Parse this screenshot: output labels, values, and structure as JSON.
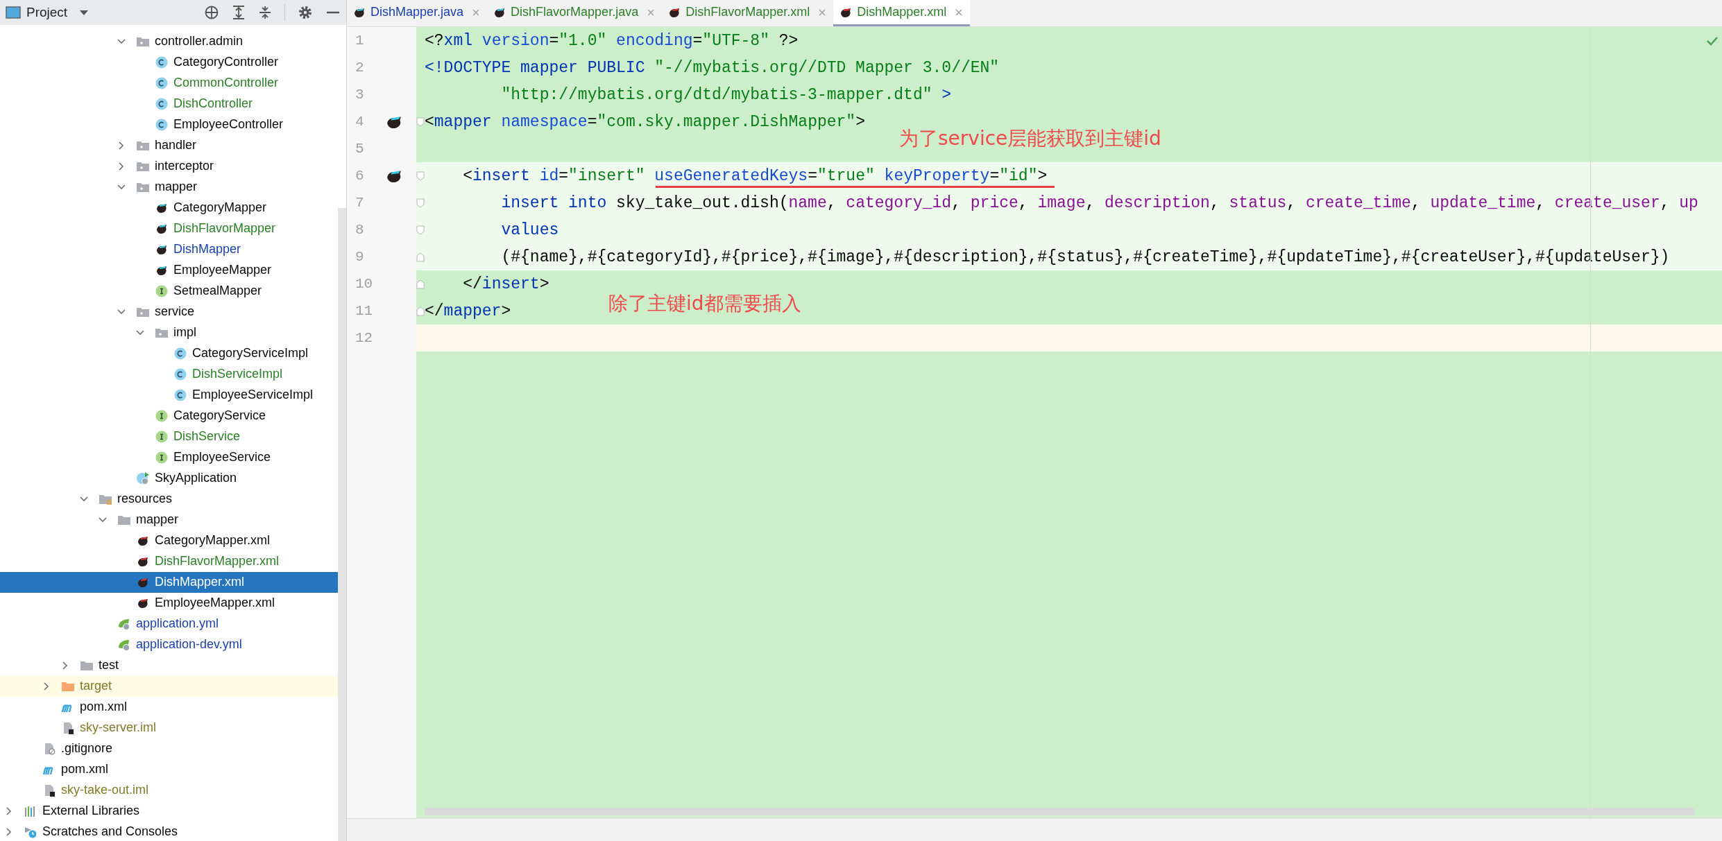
{
  "project_panel": {
    "title": "Project"
  },
  "tree": [
    {
      "children": [
        {
          "children": [
            {
              "children": [
                {
                  "children": [
                    {
                      "children": [
                        {
                          "children": [
                            {
                              "label": "controller.admin",
                              "kind": "package",
                              "color": "#080808",
                              "selected": false,
                              "expanded": true,
                              "children": [
                                {
                                  "label": "CategoryController",
                                  "kind": "class",
                                  "color": "#080808",
                                  "selected": false
                                },
                                {
                                  "label": "CommonController",
                                  "kind": "class",
                                  "color": "#2a7f27",
                                  "selected": false
                                },
                                {
                                  "label": "DishController",
                                  "kind": "class",
                                  "color": "#2a7f27",
                                  "selected": false
                                },
                                {
                                  "label": "EmployeeController",
                                  "kind": "class",
                                  "color": "#080808",
                                  "selected": false
                                }
                              ]
                            },
                            {
                              "label": "handler",
                              "kind": "package",
                              "color": "#080808",
                              "selected": false,
                              "expanded": false
                            },
                            {
                              "label": "interceptor",
                              "kind": "package",
                              "color": "#080808",
                              "selected": false,
                              "expanded": false
                            },
                            {
                              "label": "mapper",
                              "kind": "package",
                              "color": "#080808",
                              "selected": false,
                              "expanded": true,
                              "children": [
                                {
                                  "label": "CategoryMapper",
                                  "kind": "mybatis-java",
                                  "color": "#080808",
                                  "selected": false
                                },
                                {
                                  "label": "DishFlavorMapper",
                                  "kind": "mybatis-java",
                                  "color": "#2a7f27",
                                  "selected": false
                                },
                                {
                                  "label": "DishMapper",
                                  "kind": "mybatis-java",
                                  "color": "#1a3fb0",
                                  "selected": false
                                },
                                {
                                  "label": "EmployeeMapper",
                                  "kind": "mybatis-java",
                                  "color": "#080808",
                                  "selected": false
                                },
                                {
                                  "label": "SetmealMapper",
                                  "kind": "interface",
                                  "color": "#080808",
                                  "selected": false
                                }
                              ]
                            },
                            {
                              "label": "service",
                              "kind": "package",
                              "color": "#080808",
                              "selected": false,
                              "expanded": true,
                              "children": [
                                {
                                  "label": "impl",
                                  "kind": "package",
                                  "color": "#080808",
                                  "selected": false,
                                  "expanded": true,
                                  "children": [
                                    {
                                      "label": "CategoryServiceImpl",
                                      "kind": "class",
                                      "color": "#080808",
                                      "selected": false
                                    },
                                    {
                                      "label": "DishServiceImpl",
                                      "kind": "class",
                                      "color": "#2a7f27",
                                      "selected": false
                                    },
                                    {
                                      "label": "EmployeeServiceImpl",
                                      "kind": "class",
                                      "color": "#080808",
                                      "selected": false
                                    }
                                  ]
                                },
                                {
                                  "label": "CategoryService",
                                  "kind": "interface",
                                  "color": "#080808",
                                  "selected": false
                                },
                                {
                                  "label": "DishService",
                                  "kind": "interface",
                                  "color": "#2a7f27",
                                  "selected": false
                                },
                                {
                                  "label": "EmployeeService",
                                  "kind": "interface",
                                  "color": "#080808",
                                  "selected": false
                                }
                              ]
                            },
                            {
                              "label": "SkyApplication",
                              "kind": "spring-app",
                              "color": "#080808",
                              "selected": false
                            }
                          ]
                        }
                      ]
                    },
                    {
                      "label": "resources",
                      "kind": "resources",
                      "color": "#080808",
                      "selected": false,
                      "expanded": true,
                      "children": [
                        {
                          "label": "mapper",
                          "kind": "folder",
                          "color": "#080808",
                          "selected": false,
                          "expanded": true,
                          "children": [
                            {
                              "label": "CategoryMapper.xml",
                              "kind": "mybatis-xml",
                              "color": "#080808",
                              "selected": false
                            },
                            {
                              "label": "DishFlavorMapper.xml",
                              "kind": "mybatis-xml",
                              "color": "#2a7f27",
                              "selected": false
                            },
                            {
                              "label": "DishMapper.xml",
                              "kind": "mybatis-xml",
                              "selected": true
                            },
                            {
                              "label": "EmployeeMapper.xml",
                              "kind": "mybatis-xml",
                              "color": "#080808",
                              "selected": false
                            }
                          ]
                        },
                        {
                          "label": "application.yml",
                          "kind": "spring-yml",
                          "color": "#1a3fb0",
                          "selected": false
                        },
                        {
                          "label": "application-dev.yml",
                          "kind": "spring-yml",
                          "color": "#1a3fb0",
                          "selected": false
                        }
                      ]
                    }
                  ]
                },
                {
                  "label": "test",
                  "kind": "folder",
                  "color": "#080808",
                  "selected": false,
                  "expanded": false
                }
              ]
            },
            {
              "label": "target",
              "kind": "excluded",
              "color": "#827a2a",
              "selected": false,
              "expanded": false
            },
            {
              "label": "pom.xml",
              "kind": "maven",
              "color": "#080808",
              "selected": false
            },
            {
              "label": "sky-server.iml",
              "kind": "iml",
              "color": "#827a2a",
              "selected": false
            }
          ]
        },
        {
          "label": ".gitignore",
          "kind": "gitignore",
          "color": "#080808",
          "selected": false
        },
        {
          "label": "pom.xml",
          "kind": "maven",
          "color": "#080808",
          "selected": false
        },
        {
          "label": "sky-take-out.iml",
          "kind": "iml",
          "color": "#827a2a",
          "selected": false
        }
      ]
    },
    {
      "label": "External Libraries",
      "kind": "libraries",
      "color": "#080808",
      "selected": false,
      "expanded": false
    },
    {
      "label": "Scratches and Consoles",
      "kind": "scratches",
      "color": "#080808",
      "selected": false,
      "expanded": false
    }
  ],
  "tabs": [
    {
      "label": "DishMapper.java",
      "kind": "mybatis-java",
      "color": "#1a3fb0",
      "selected": false
    },
    {
      "label": "DishFlavorMapper.java",
      "kind": "mybatis-java",
      "color": "#2a7f27",
      "selected": false
    },
    {
      "label": "DishFlavorMapper.xml",
      "kind": "mybatis-xml",
      "color": "#2a7f27",
      "selected": false
    },
    {
      "label": "DishMapper.xml",
      "kind": "mybatis-xml",
      "color": "#2a7f27",
      "selected": true
    }
  ],
  "code_lines": [
    {
      "number": "1",
      "changed": false,
      "current": false,
      "tokens": [
        {
          "kind": "punct",
          "text": "<?"
        },
        {
          "kind": "tag",
          "text": "xml"
        },
        {
          "kind": "attr",
          "text": " version"
        },
        {
          "kind": "punct",
          "text": "="
        },
        {
          "kind": "value",
          "text": "\"1.0\""
        },
        {
          "kind": "attr",
          "text": " encoding"
        },
        {
          "kind": "punct",
          "text": "="
        },
        {
          "kind": "value",
          "text": "\"UTF-8\""
        },
        {
          "kind": "punct",
          "text": " ?>"
        }
      ]
    },
    {
      "number": "2",
      "changed": false,
      "current": false,
      "tokens": [
        {
          "kind": "tag",
          "text": "<!DOCTYPE mapper PUBLIC "
        },
        {
          "kind": "value",
          "text": "\"-//mybatis.org//DTD Mapper 3.0//EN\""
        }
      ]
    },
    {
      "number": "3",
      "changed": false,
      "current": false,
      "tokens": [
        {
          "kind": "value",
          "text": "        \"http://mybatis.org/dtd/mybatis-3-mapper.dtd\""
        },
        {
          "kind": "tag",
          "text": " >"
        }
      ]
    },
    {
      "number": "4",
      "changed": false,
      "current": false,
      "gutter_icon": true,
      "fold_open": true,
      "tokens": [
        {
          "kind": "punct",
          "text": "<"
        },
        {
          "kind": "tag",
          "text": "mapper"
        },
        {
          "kind": "attr",
          "text": " namespace"
        },
        {
          "kind": "punct",
          "text": "="
        },
        {
          "kind": "value",
          "text": "\"com.sky.mapper.DishMapper\""
        },
        {
          "kind": "punct",
          "text": ">"
        }
      ]
    },
    {
      "number": "5",
      "changed": false,
      "current": false
    },
    {
      "number": "6",
      "changed": true,
      "current": false,
      "gutter_icon": true,
      "fold_open": true,
      "tokens": [
        {
          "kind": "punct",
          "text": "    <"
        },
        {
          "kind": "tag",
          "text": "insert"
        },
        {
          "kind": "attr",
          "text": " id"
        },
        {
          "kind": "punct",
          "text": "="
        },
        {
          "kind": "value",
          "text": "\"insert\""
        },
        {
          "kind": "attr",
          "text": " useGeneratedKeys"
        },
        {
          "kind": "punct",
          "text": "="
        },
        {
          "kind": "value",
          "text": "\"true\""
        },
        {
          "kind": "attr",
          "text": " keyProperty"
        },
        {
          "kind": "punct",
          "text": "="
        },
        {
          "kind": "value",
          "text": "\"id\""
        },
        {
          "kind": "punct",
          "text": ">"
        }
      ]
    },
    {
      "number": "7",
      "changed": true,
      "current": false,
      "fold_open": true,
      "tokens": [
        {
          "kind": "keyword",
          "text": "        insert into"
        },
        {
          "kind": "punct",
          "text": " sky_take_out.dish("
        },
        {
          "kind": "column",
          "text": "name"
        },
        {
          "kind": "punct",
          "text": ","
        },
        {
          "kind": "column",
          "text": " category_id"
        },
        {
          "kind": "punct",
          "text": ","
        },
        {
          "kind": "column",
          "text": " price"
        },
        {
          "kind": "punct",
          "text": ","
        },
        {
          "kind": "column",
          "text": " image"
        },
        {
          "kind": "punct",
          "text": ","
        },
        {
          "kind": "column",
          "text": " description"
        },
        {
          "kind": "punct",
          "text": ","
        },
        {
          "kind": "column",
          "text": " status"
        },
        {
          "kind": "punct",
          "text": ","
        },
        {
          "kind": "column",
          "text": " create_time"
        },
        {
          "kind": "punct",
          "text": ","
        },
        {
          "kind": "column",
          "text": " update_time"
        },
        {
          "kind": "punct",
          "text": ","
        },
        {
          "kind": "column",
          "text": " create_user"
        },
        {
          "kind": "punct",
          "text": ","
        },
        {
          "kind": "column",
          "text": " up"
        }
      ]
    },
    {
      "number": "8",
      "changed": true,
      "current": false,
      "fold_open": true,
      "tokens": [
        {
          "kind": "keyword",
          "text": "        values"
        }
      ]
    },
    {
      "number": "9",
      "changed": true,
      "current": false,
      "fold_close": true,
      "tokens": [
        {
          "kind": "punct",
          "text": "        (#{name},#{categoryId},#{price},#{image},#{description},#{status},#{createTime},#{updateTime},#{createUser},#{updateUser})"
        }
      ]
    },
    {
      "number": "10",
      "changed": false,
      "current": false,
      "fold_close": true,
      "tokens": [
        {
          "kind": "punct",
          "text": "    </"
        },
        {
          "kind": "tag",
          "text": "insert"
        },
        {
          "kind": "punct",
          "text": ">"
        }
      ]
    },
    {
      "number": "11",
      "changed": false,
      "current": false,
      "fold_close": true,
      "tokens": [
        {
          "kind": "punct",
          "text": "</"
        },
        {
          "kind": "tag",
          "text": "mapper"
        },
        {
          "kind": "punct",
          "text": ">"
        }
      ]
    },
    {
      "number": "12",
      "changed": false,
      "current": true
    }
  ],
  "annotations": [
    {
      "text": "为了service层能获取到主键id",
      "kind": "top-note"
    },
    {
      "text": "除了主键id都需要插入",
      "kind": "bottom-note"
    }
  ]
}
